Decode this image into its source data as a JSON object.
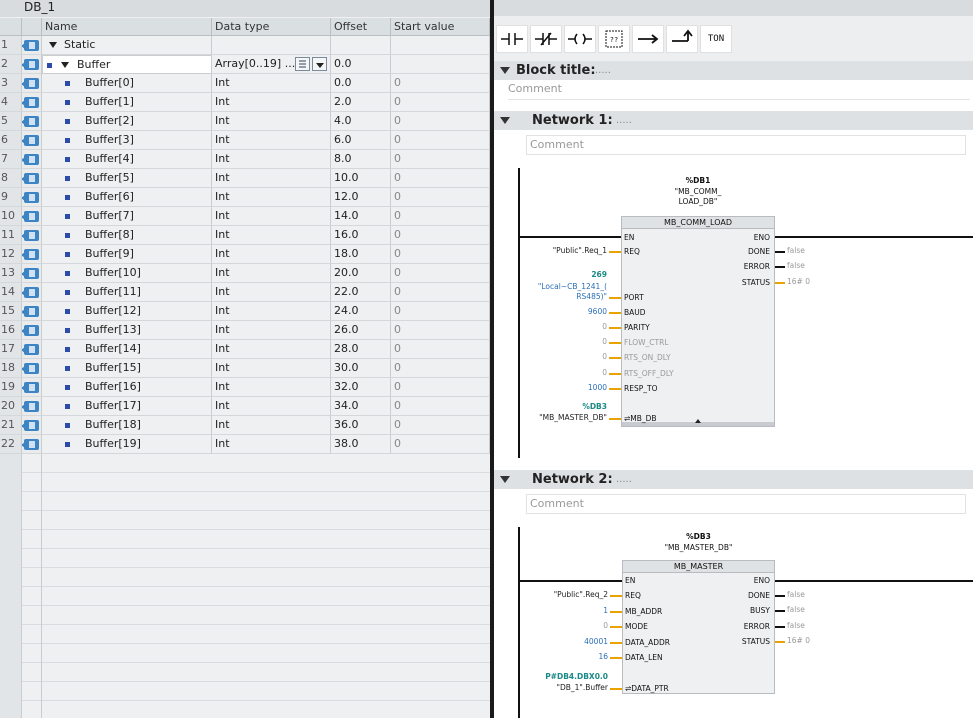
{
  "db_title": "DB_1",
  "columns": [
    "Name",
    "Data type",
    "Offset",
    "Start value"
  ],
  "rows": [
    {
      "num": "1",
      "name": "Static",
      "type": "",
      "offset": "",
      "start": "",
      "kind": "static"
    },
    {
      "num": "2",
      "name": "Buffer",
      "type": "Array[0..19] ...",
      "offset": "0.0",
      "start": "",
      "kind": "buffer"
    },
    {
      "num": "3",
      "name": "Buffer[0]",
      "type": "Int",
      "offset": "0.0",
      "start": "0",
      "kind": "elem"
    },
    {
      "num": "4",
      "name": "Buffer[1]",
      "type": "Int",
      "offset": "2.0",
      "start": "0",
      "kind": "elem"
    },
    {
      "num": "5",
      "name": "Buffer[2]",
      "type": "Int",
      "offset": "4.0",
      "start": "0",
      "kind": "elem"
    },
    {
      "num": "6",
      "name": "Buffer[3]",
      "type": "Int",
      "offset": "6.0",
      "start": "0",
      "kind": "elem"
    },
    {
      "num": "7",
      "name": "Buffer[4]",
      "type": "Int",
      "offset": "8.0",
      "start": "0",
      "kind": "elem"
    },
    {
      "num": "8",
      "name": "Buffer[5]",
      "type": "Int",
      "offset": "10.0",
      "start": "0",
      "kind": "elem"
    },
    {
      "num": "9",
      "name": "Buffer[6]",
      "type": "Int",
      "offset": "12.0",
      "start": "0",
      "kind": "elem"
    },
    {
      "num": "10",
      "name": "Buffer[7]",
      "type": "Int",
      "offset": "14.0",
      "start": "0",
      "kind": "elem"
    },
    {
      "num": "11",
      "name": "Buffer[8]",
      "type": "Int",
      "offset": "16.0",
      "start": "0",
      "kind": "elem"
    },
    {
      "num": "12",
      "name": "Buffer[9]",
      "type": "Int",
      "offset": "18.0",
      "start": "0",
      "kind": "elem"
    },
    {
      "num": "13",
      "name": "Buffer[10]",
      "type": "Int",
      "offset": "20.0",
      "start": "0",
      "kind": "elem"
    },
    {
      "num": "14",
      "name": "Buffer[11]",
      "type": "Int",
      "offset": "22.0",
      "start": "0",
      "kind": "elem"
    },
    {
      "num": "15",
      "name": "Buffer[12]",
      "type": "Int",
      "offset": "24.0",
      "start": "0",
      "kind": "elem"
    },
    {
      "num": "16",
      "name": "Buffer[13]",
      "type": "Int",
      "offset": "26.0",
      "start": "0",
      "kind": "elem"
    },
    {
      "num": "17",
      "name": "Buffer[14]",
      "type": "Int",
      "offset": "28.0",
      "start": "0",
      "kind": "elem"
    },
    {
      "num": "18",
      "name": "Buffer[15]",
      "type": "Int",
      "offset": "30.0",
      "start": "0",
      "kind": "elem"
    },
    {
      "num": "19",
      "name": "Buffer[16]",
      "type": "Int",
      "offset": "32.0",
      "start": "0",
      "kind": "elem"
    },
    {
      "num": "20",
      "name": "Buffer[17]",
      "type": "Int",
      "offset": "34.0",
      "start": "0",
      "kind": "elem"
    },
    {
      "num": "21",
      "name": "Buffer[18]",
      "type": "Int",
      "offset": "36.0",
      "start": "0",
      "kind": "elem"
    },
    {
      "num": "22",
      "name": "Buffer[19]",
      "type": "Int",
      "offset": "38.0",
      "start": "0",
      "kind": "elem"
    }
  ],
  "toolbar": {
    "ton_label": "TON",
    "box_label": "??"
  },
  "block": {
    "title_label": "Block title:",
    "dots": ".....",
    "comment": "Comment"
  },
  "network1": {
    "title": "Network 1:",
    "dots": ".....",
    "comment": "Comment",
    "instance_addr": "%DB1",
    "instance_name": "\"MB_COMM_\nLOAD_DB\"",
    "box_title": "MB_COMM_LOAD",
    "en": "EN",
    "eno": "ENO",
    "inputs": [
      {
        "pin": "REQ",
        "arg": "\"Public\".Req_1",
        "argcls": "",
        "pincls": ""
      },
      {
        "pin": "PORT",
        "arg": "\"Local~CB_1241_(\nRS485)\"",
        "argtop": "269",
        "argcls": "blue",
        "pincls": ""
      },
      {
        "pin": "BAUD",
        "arg": "9600",
        "argcls": "blue",
        "pincls": ""
      },
      {
        "pin": "PARITY",
        "arg": "0",
        "argcls": "gray",
        "pincls": ""
      },
      {
        "pin": "FLOW_CTRL",
        "arg": "0",
        "argcls": "gray",
        "pincls": "g"
      },
      {
        "pin": "RTS_ON_DLY",
        "arg": "0",
        "argcls": "gray",
        "pincls": "g"
      },
      {
        "pin": "RTS_OFF_DLY",
        "arg": "0",
        "argcls": "gray",
        "pincls": "g"
      },
      {
        "pin": "RESP_TO",
        "arg": "1000",
        "argcls": "blue",
        "pincls": ""
      },
      {
        "pin": "⇌MB_DB",
        "arg": "\"MB_MASTER_DB\"",
        "argtop": "%DB3",
        "argcls": "",
        "pincls": ""
      }
    ],
    "outputs": [
      {
        "pin": "DONE",
        "val": "false"
      },
      {
        "pin": "ERROR",
        "val": "false"
      },
      {
        "pin": "STATUS",
        "val": "16# 0"
      }
    ]
  },
  "network2": {
    "title": "Network 2:",
    "dots": ".....",
    "comment": "Comment",
    "instance_addr": "%DB3",
    "instance_name": "\"MB_MASTER_DB\"",
    "box_title": "MB_MASTER",
    "en": "EN",
    "eno": "ENO",
    "inputs": [
      {
        "pin": "REQ",
        "arg": "\"Public\".Req_2",
        "argcls": ""
      },
      {
        "pin": "MB_ADDR",
        "arg": "1",
        "argcls": "blue"
      },
      {
        "pin": "MODE",
        "arg": "0",
        "argcls": "gray"
      },
      {
        "pin": "DATA_ADDR",
        "arg": "40001",
        "argcls": "blue"
      },
      {
        "pin": "DATA_LEN",
        "arg": "16",
        "argcls": "blue"
      },
      {
        "pin": "⇌DATA_PTR",
        "arg": "\"DB_1\".Buffer",
        "argtop": "P#DB4.DBX0.0",
        "argcls": ""
      }
    ],
    "outputs": [
      {
        "pin": "DONE",
        "val": "false"
      },
      {
        "pin": "BUSY",
        "val": "false"
      },
      {
        "pin": "ERROR",
        "val": "false"
      },
      {
        "pin": "STATUS",
        "val": "16# 0"
      }
    ]
  }
}
